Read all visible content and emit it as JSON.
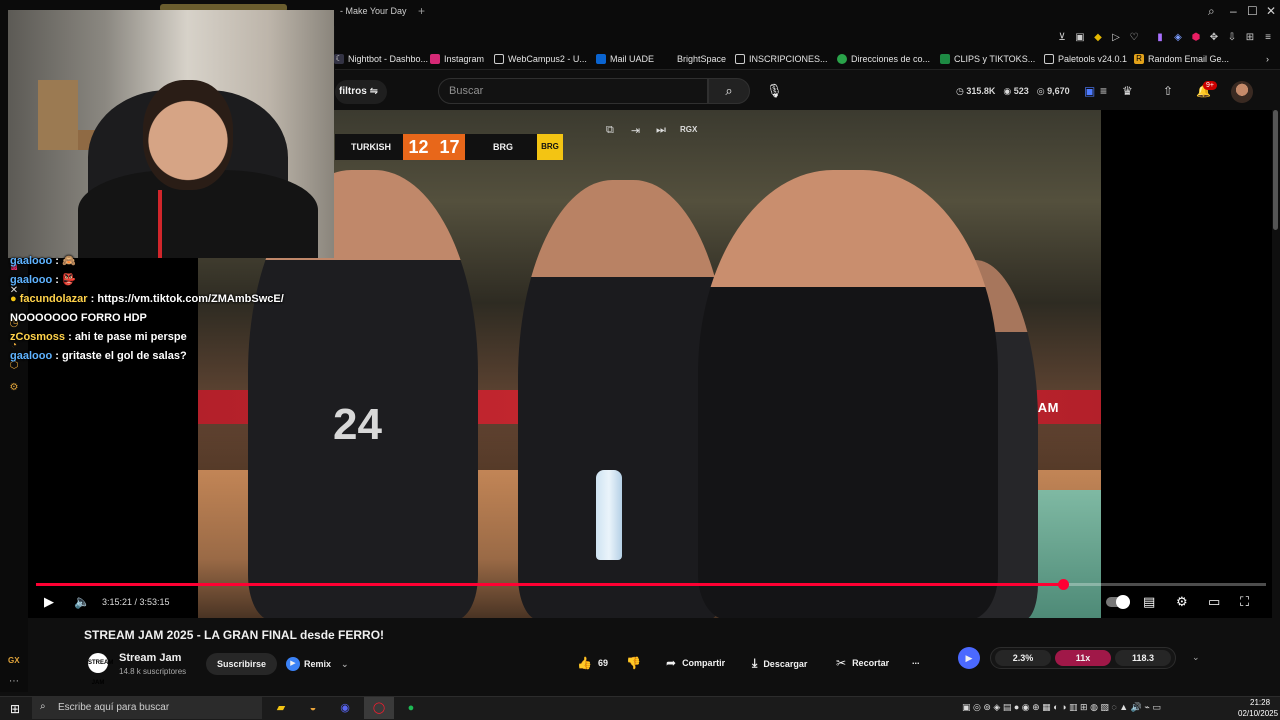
{
  "browser": {
    "tab_title": "- Make Your Day",
    "bookmarks": [
      {
        "label": "Nightbot - Dashbo...",
        "icon": "nightbot-icon"
      },
      {
        "label": "Instagram",
        "icon": "instagram-icon"
      },
      {
        "label": "WebCampus2 - U...",
        "icon": "page-icon"
      },
      {
        "label": "Mail UADE",
        "icon": "outlook-icon"
      },
      {
        "label": "BrightSpace",
        "icon": "page-icon"
      },
      {
        "label": "INSCRIPCIONES...",
        "icon": "page-icon"
      },
      {
        "label": "Direcciones de co...",
        "icon": "globe-icon"
      },
      {
        "label": "CLIPS y TIKTOKS...",
        "icon": "sheets-icon"
      },
      {
        "label": "Paletools v24.0.1",
        "icon": "page-icon"
      },
      {
        "label": "Random Email Ge...",
        "icon": "r-icon"
      }
    ]
  },
  "youtube": {
    "filters_label": "filtros",
    "search_placeholder": "Buscar",
    "stats": {
      "views": "315.8K",
      "viewers": "523",
      "likes": "9,670"
    },
    "notifications_badge": "9+"
  },
  "player": {
    "scoreboard": {
      "home": "TURKISH",
      "home_score": "12",
      "away_score": "17",
      "away": "BRG",
      "logo": "BRG"
    },
    "top_label": "RGX",
    "ad_text": "STREAM JAM",
    "jersey_number": "24",
    "time": "3:15:21 / 3:53:15",
    "progress_fraction": 0.835
  },
  "chat": [
    {
      "user": "gaalooo",
      "text": ": 🙈",
      "gold": false
    },
    {
      "user": "gaalooo",
      "text": ": 👺",
      "gold": false
    },
    {
      "user": "facundolazar",
      "text": ": https://vm.tiktok.com/ZMAmbSwcE/",
      "gold": true
    },
    {
      "user": "",
      "text": "NOOOOOOO FORRO HDP",
      "gold": false
    },
    {
      "user": "zCosmoss",
      "text": ": ahi te pase mi perspe",
      "gold": true
    },
    {
      "user": "gaalooo",
      "text": ": gritaste el gol de salas?",
      "gold": false
    }
  ],
  "video": {
    "title": "STREAM JAM 2025 - LA GRAN FINAL desde FERRO!",
    "channel": "Stream Jam",
    "channel_avatar_text": "STREAM JAM",
    "subscribers": "14.8 k suscriptores",
    "subscribe_label": "Suscribirse",
    "remix_label": "Remix",
    "likes": "69",
    "share_label": "Compartir",
    "download_label": "Descargar",
    "clip_label": "Recortar",
    "more_label": "..."
  },
  "extension": {
    "value1": "2.3%",
    "value2": "11x",
    "value3": "118.3"
  },
  "sidebar_label": "GX",
  "taskbar": {
    "search_placeholder": "Escribe aquí para buscar",
    "time": "21:28",
    "date": "02/10/2025"
  },
  "colors": {
    "accent": "#ff0033",
    "score_orange": "#e8671a",
    "pill_highlight": "#a01848"
  }
}
